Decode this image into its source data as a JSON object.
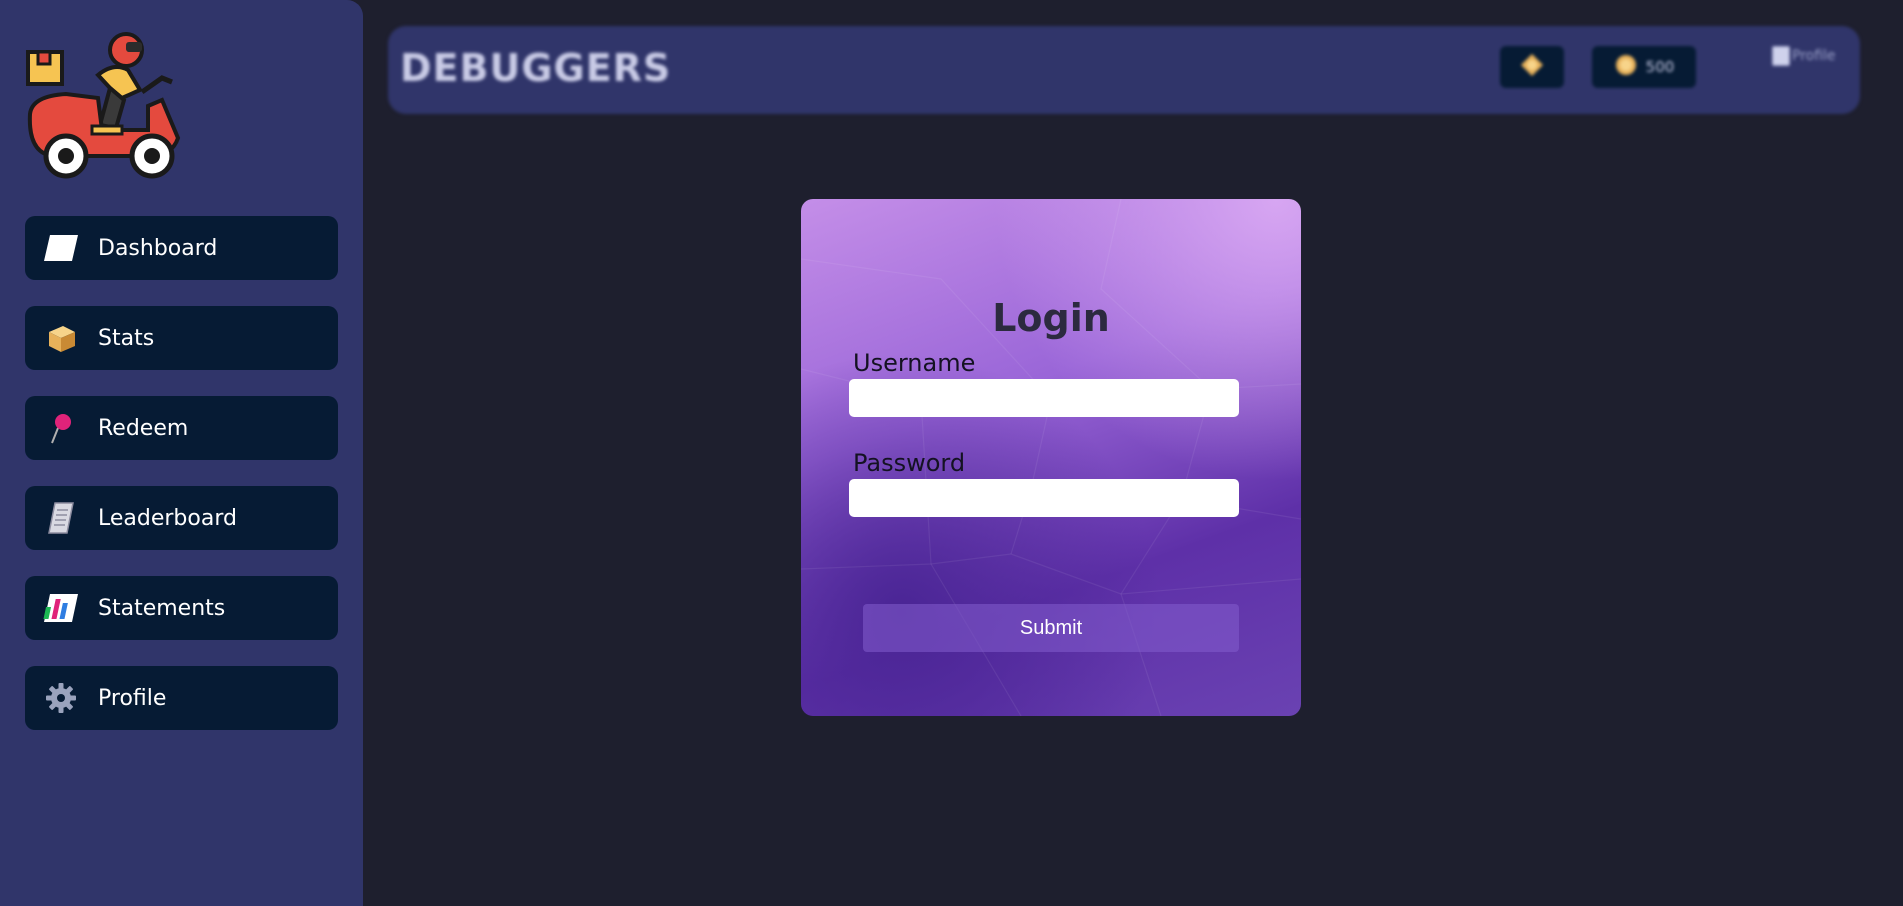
{
  "header": {
    "brand": "DEBUGGERS",
    "coins": "500",
    "profile_alt": "Profile"
  },
  "sidebar": {
    "items": [
      {
        "label": "Dashboard",
        "icon": "dashboard-icon"
      },
      {
        "label": "Stats",
        "icon": "package-icon"
      },
      {
        "label": "Redeem",
        "icon": "pushpin-icon"
      },
      {
        "label": "Leaderboard",
        "icon": "scroll-icon"
      },
      {
        "label": "Statements",
        "icon": "bar-chart-icon"
      },
      {
        "label": "Profile",
        "icon": "gear-icon"
      }
    ]
  },
  "login": {
    "title": "Login",
    "username_label": "Username",
    "username_value": "",
    "password_label": "Password",
    "password_value": "",
    "submit_label": "Submit"
  },
  "colors": {
    "page_bg": "#1e1f2e",
    "sidebar_bg": "#30356a",
    "nav_item_bg": "#061b34",
    "card_accent": "#9a66d8"
  }
}
